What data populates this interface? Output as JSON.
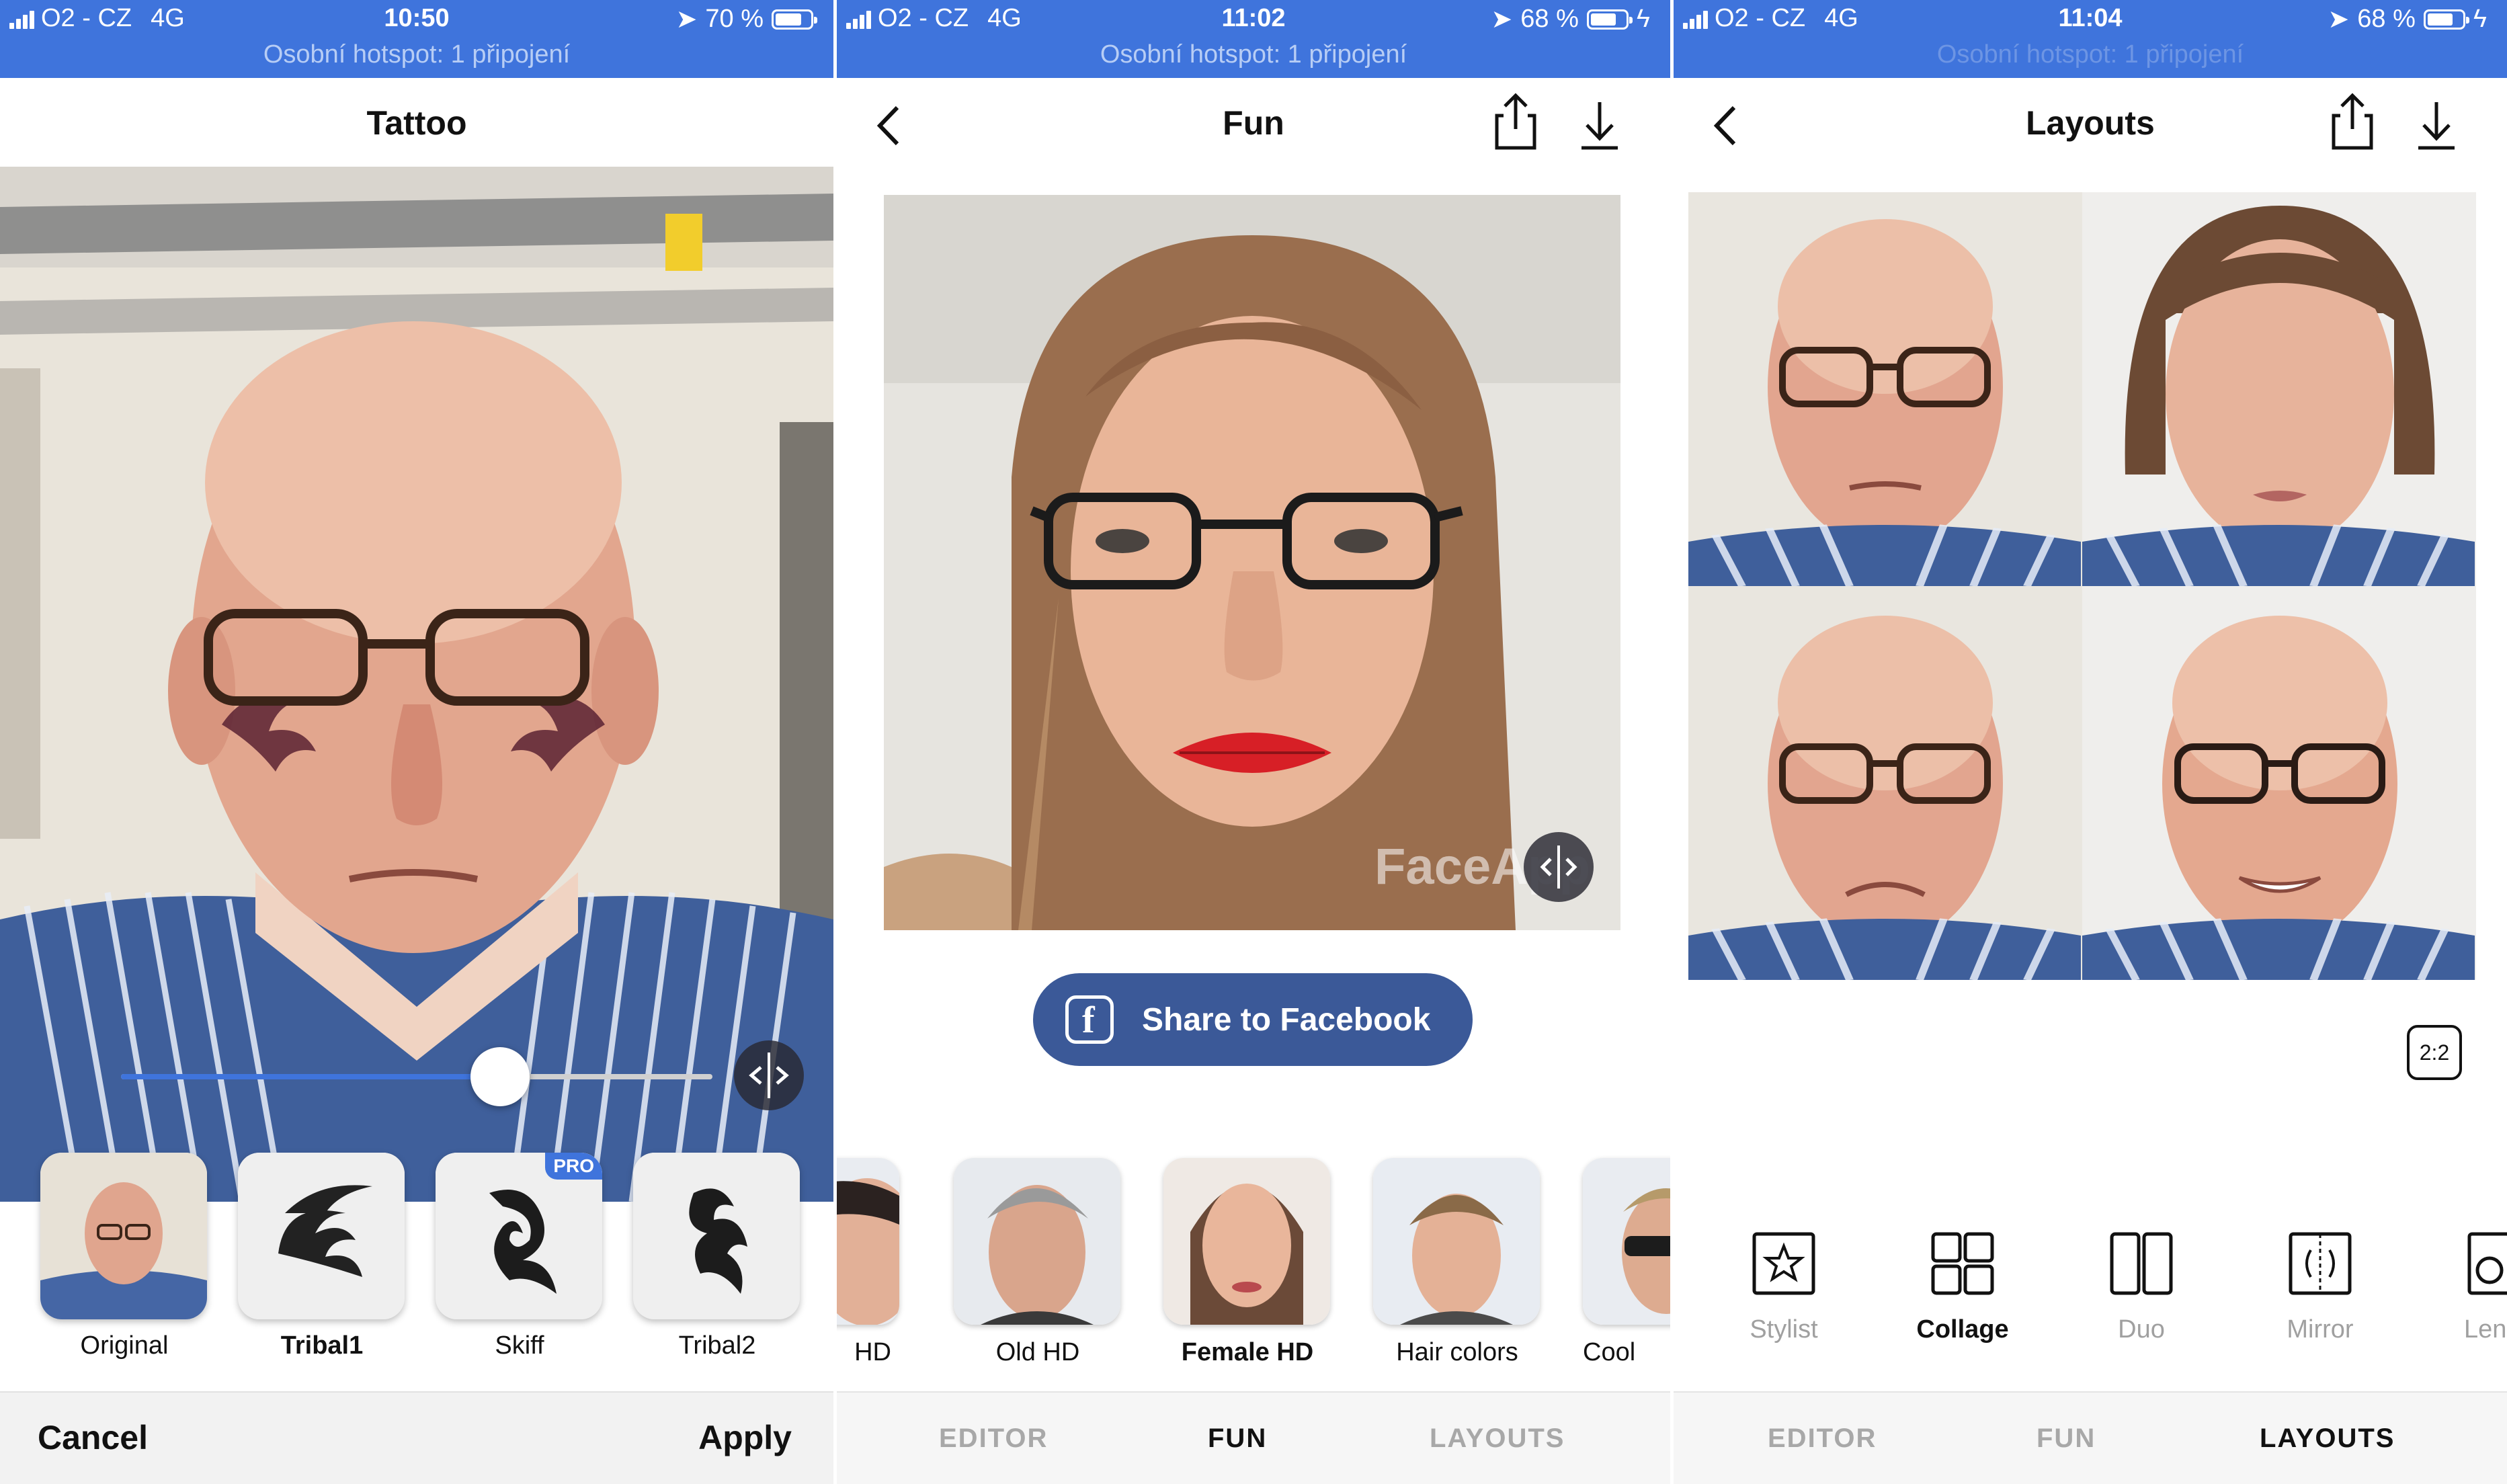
{
  "status_bars": [
    {
      "carrier": "O2 - CZ",
      "network": "4G",
      "time": "10:50",
      "battery": "70 %",
      "battery_level": 0.7,
      "hotspot": "Osobní hotspot: 1 připojení"
    },
    {
      "carrier": "O2 - CZ",
      "network": "4G",
      "time": "11:02",
      "battery": "68 %",
      "battery_level": 0.68,
      "hotspot": "Osobní hotspot: 1 připojení"
    },
    {
      "carrier": "O2 - CZ",
      "network": "4G",
      "time": "11:04",
      "battery": "68 %",
      "battery_level": 0.68,
      "hotspot": "Osobní hotspot: 1 připojení"
    }
  ],
  "tattoo_screen": {
    "title": "Tattoo",
    "slider_value": 0.64,
    "thumbnails": [
      {
        "label": "Original",
        "selected": false,
        "pro": false
      },
      {
        "label": "Tribal1",
        "selected": true,
        "pro": false
      },
      {
        "label": "Skiff",
        "selected": false,
        "pro": true
      },
      {
        "label": "Tribal2",
        "selected": false,
        "pro": false
      }
    ],
    "pro_badge": "PRO",
    "cancel": "Cancel",
    "apply": "Apply"
  },
  "fun_screen": {
    "title": "Fun",
    "watermark": "FaceApp",
    "share_facebook": "Share to Facebook",
    "filters": [
      {
        "label": "HD",
        "selected": false
      },
      {
        "label": "Old HD",
        "selected": false
      },
      {
        "label": "Female HD",
        "selected": true
      },
      {
        "label": "Hair colors",
        "selected": false
      },
      {
        "label": "Cool",
        "selected": false
      }
    ]
  },
  "layouts_screen": {
    "title": "Layouts",
    "ratio": "2:2",
    "layouts": [
      {
        "label": "Stylist",
        "icon": "star-frame-icon",
        "selected": false
      },
      {
        "label": "Collage",
        "icon": "grid-icon",
        "selected": true
      },
      {
        "label": "Duo",
        "icon": "split-icon",
        "selected": false
      },
      {
        "label": "Mirror",
        "icon": "mirror-icon",
        "selected": false
      },
      {
        "label": "Lens",
        "icon": "lens-icon",
        "selected": false
      }
    ]
  },
  "tabs": {
    "editor": "EDITOR",
    "fun": "FUN",
    "layouts": "LAYOUTS"
  },
  "colors": {
    "accent": "#3f74dc",
    "facebook": "#3b5998",
    "lipstick": "#d71f26",
    "tattoo": "#5b2233"
  }
}
